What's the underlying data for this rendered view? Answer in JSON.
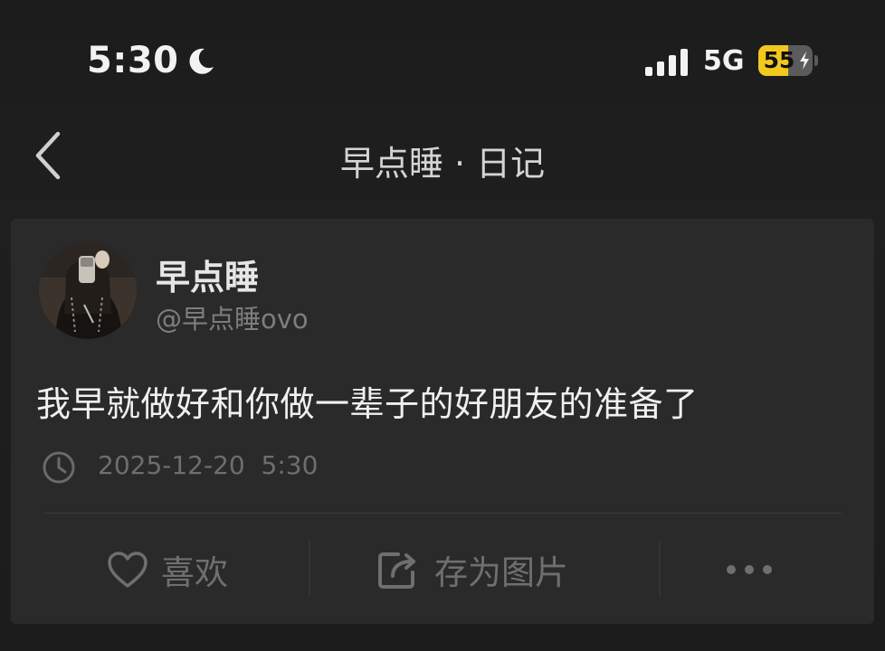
{
  "status_bar": {
    "time": "5:30",
    "network": "5G",
    "battery": "55",
    "battery_level": 0.55,
    "icons": [
      "moon-icon",
      "signal-icon",
      "bolt-icon"
    ]
  },
  "nav": {
    "title": "早点睡 · 日记",
    "back_icon": "chevron-left-icon"
  },
  "post": {
    "author_name": "早点睡",
    "author_handle": "@早点睡ovo",
    "text": "我早就做好和你做一辈子的好朋友的准备了",
    "timestamp": "2025-12-20  5:30"
  },
  "actions": {
    "like_label": "喜欢",
    "save_label": "存为图片",
    "icons": [
      "heart-icon",
      "share-out-icon",
      "more-icon"
    ]
  },
  "colors": {
    "background": "#1f1f1f",
    "card": "#2a2a2a",
    "battery_accent": "#f2c81e",
    "muted_text": "#6f6f6f"
  }
}
